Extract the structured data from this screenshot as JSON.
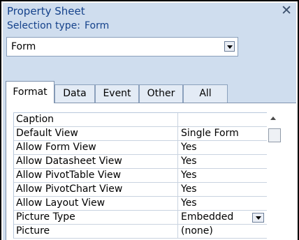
{
  "window": {
    "title": "Property Sheet",
    "close_glyph": "✕",
    "close_icon": "close-icon"
  },
  "selection": {
    "label": "Selection type:",
    "value": "Form"
  },
  "object_select": {
    "value": "Form",
    "icon": "chevron-down-icon"
  },
  "tabs": [
    {
      "label": "Format",
      "active": true
    },
    {
      "label": "Data",
      "active": false
    },
    {
      "label": "Event",
      "active": false
    },
    {
      "label": "Other",
      "active": false
    },
    {
      "label": "All",
      "active": false
    }
  ],
  "properties": [
    {
      "name": "Caption",
      "value": ""
    },
    {
      "name": "Default View",
      "value": "Single Form"
    },
    {
      "name": "Allow Form View",
      "value": "Yes"
    },
    {
      "name": "Allow Datasheet View",
      "value": "Yes"
    },
    {
      "name": "Allow PivotTable View",
      "value": "Yes"
    },
    {
      "name": "Allow PivotChart View",
      "value": "Yes"
    },
    {
      "name": "Allow Layout View",
      "value": "Yes"
    },
    {
      "name": "Picture Type",
      "value": "Embedded",
      "has_dropdown": true
    },
    {
      "name": "Picture",
      "value": "(none)"
    }
  ],
  "colors": {
    "panel_bg": "#cfddee",
    "title_text": "#15428b",
    "grid_line": "#c9d3e0"
  }
}
